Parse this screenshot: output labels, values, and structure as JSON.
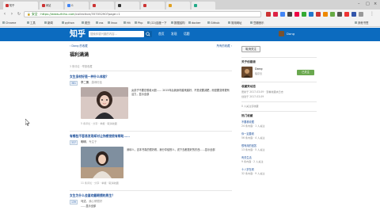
{
  "browser": {
    "tabs": [
      {
        "label": "知乎",
        "active": true
      },
      {
        "label": "网站",
        "active": false
      },
      {
        "label": "G",
        "active": false
      },
      {
        "label": "",
        "active": false
      },
      {
        "label": "",
        "active": false
      },
      {
        "label": "",
        "active": false
      },
      {
        "label": "",
        "active": false
      },
      {
        "label": "",
        "active": false
      }
    ],
    "url_secure": "安全",
    "url_host": "https://www.zhihu.com",
    "url_rest": "/collection/35705290?page=1",
    "bookmarks": [
      "Chrome",
      "工具",
      "新闻",
      "python",
      "爬虫",
      "css",
      "linux",
      "Hit",
      "Php",
      "(22)百度一下",
      "数据结构",
      "docker",
      "Github",
      "常用网址",
      "豆瓣音乐",
      "其他书签"
    ]
  },
  "zhihu": {
    "logo": "知乎",
    "search_placeholder": "搜索你感兴趣的内容...",
    "nav": [
      "首页",
      "发现",
      "话题"
    ],
    "user_name": "Dong"
  },
  "collection": {
    "breadcrumb": "‹ Dong 的收藏",
    "breadcrumb_right": "所有的收藏 ›",
    "title": "福利满满",
    "meta": "3 条评论 · 举报收藏",
    "items": [
      {
        "question": "女生身材好是一种什么体验？",
        "votes": "381",
        "author": "李二蛋",
        "signature": "，游戏行业",
        "body": "女孩子不要总想着大胆…… 2015年后我身材越来越好，不是说要减肥，而是要变得更有活力，显示全部",
        "meta": "5 条评论 · 分享 · 举报 · 取消收藏"
      },
      {
        "question": "有哪些不容易发现却对让你感觉很有帮助……",
        "votes": "337",
        "author": "明明",
        "signature": "，专注于",
        "body": "深圳人，这本书真的很好看，我分享给别人，说下去都是好的东西……显示全部",
        "meta": "11 条评论 · 分享 · 举报 · 取消收藏"
      },
      {
        "question": "女生为什么会喜欢戴眼镜的男生？",
        "votes": "139",
        "author": "马达",
        "signature": "，我心情很好",
        "body": "……显示全部",
        "meta": ""
      }
    ]
  },
  "sidebar": {
    "follow_label": "取消关注",
    "creator_head": "关于创建者",
    "creator_name": "Dong",
    "creator_sub": "程序员",
    "follow_green": "已关注",
    "activity_head": "收藏夹动态",
    "activity_1": "更新于 2017-03-09 · 查看收藏夹日志",
    "activity_2": "创建于 2017-03-09",
    "followers_head": "0 人关注该收藏",
    "hot_head": "热门收藏",
    "hot": [
      {
        "title": "不要看收藏",
        "sub": "24 条内容 · 1 人关注"
      },
      {
        "title": "你一定要看",
        "sub": "56 条内容 · 4 人关注"
      },
      {
        "title": "很有用的回答",
        "sub": "13 条内容 · 5 人关注"
      },
      {
        "title": "有关生活",
        "sub": "9 条内容 · 2 人关注"
      },
      {
        "title": "十八岁在看",
        "sub": "32 条内容 · 9 人关注"
      }
    ]
  },
  "colors": {
    "zhihu_blue": "#0c6bbf",
    "link_blue": "#1a4d99",
    "green_button": "#6aa84f"
  }
}
